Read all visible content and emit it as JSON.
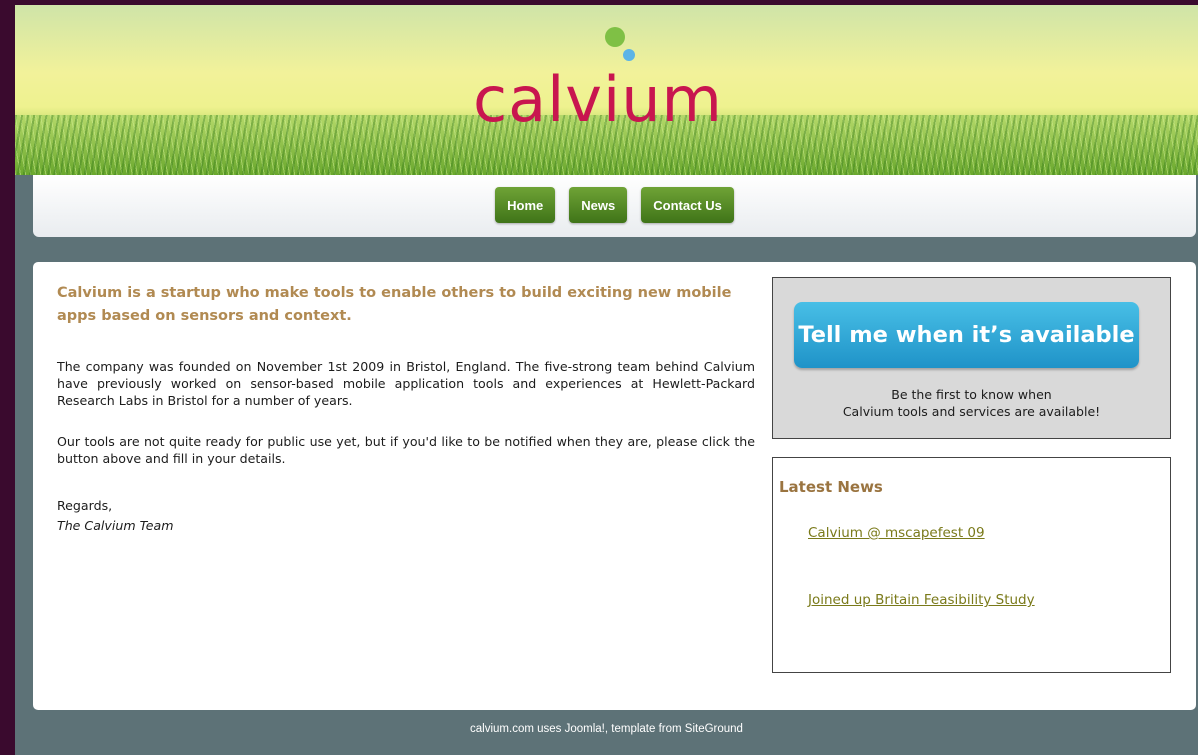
{
  "header": {
    "logo_text": "calvium"
  },
  "nav": {
    "items": [
      {
        "label": "Home"
      },
      {
        "label": "News"
      },
      {
        "label": "Contact Us"
      }
    ]
  },
  "main": {
    "intro": "Calvium is a startup who make tools to enable others to build exciting new mobile apps based on sensors and context.",
    "paragraphs": [
      "The company was founded on November 1st 2009 in Bristol, England.  The five-strong team behind Calvium have previously worked on sensor-based mobile application tools and experiences at Hewlett-Packard Research Labs in Bristol for a number of years.",
      "Our tools are not quite ready for public use yet, but if you'd like to be notified when they are, please click the button above and fill in your details."
    ],
    "regards": "Regards,",
    "signature": "The Calvium Team"
  },
  "notify": {
    "button_label": "Tell me when it’s available",
    "line1": "Be the first to know when",
    "line2": "Calvium tools and services are available!"
  },
  "news": {
    "title": "Latest News",
    "items": [
      {
        "label": "Calvium @ mscapefest 09"
      },
      {
        "label": "Joined up Britain Feasibility Study"
      }
    ]
  },
  "footer": {
    "text": "calvium.com uses Joomla!, template from SiteGround"
  },
  "colors": {
    "page_background": "#3a0a2e",
    "frame_background": "#5d7277",
    "logo": "#c8164f",
    "nav_button": "#4d8424",
    "intro_text": "#b18a52",
    "cta_button": "#2ba6d9",
    "news_title": "#9a7440",
    "news_link": "#7a7a1a"
  }
}
